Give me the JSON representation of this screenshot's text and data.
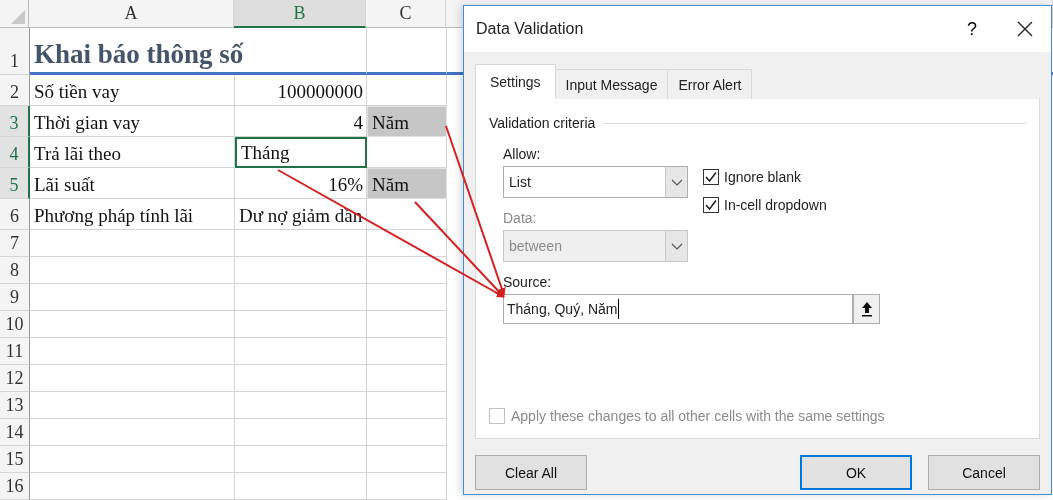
{
  "sheet": {
    "columns": [
      {
        "label": "A",
        "selected": false
      },
      {
        "label": "B",
        "selected": true
      },
      {
        "label": "C",
        "selected": false
      }
    ],
    "rows": [
      {
        "number": "1",
        "selected": false,
        "cells": [
          {
            "text": "Khai báo thông số",
            "kind": "title",
            "selected": false,
            "shaded": false
          },
          {
            "selected": false,
            "shaded": false
          },
          {
            "selected": false,
            "shaded": false
          }
        ]
      },
      {
        "number": "2",
        "selected": false,
        "cells": [
          {
            "text": "Số tiền vay",
            "kind": "text",
            "selected": false,
            "shaded": false
          },
          {
            "text": "100000000",
            "kind": "number",
            "selected": false,
            "shaded": false
          },
          {
            "selected": false,
            "shaded": false
          }
        ]
      },
      {
        "number": "3",
        "selected": true,
        "cells": [
          {
            "text": "Thời gian vay",
            "kind": "text",
            "selected": false,
            "shaded": false
          },
          {
            "text": "4",
            "kind": "number",
            "selected": false,
            "shaded": false
          },
          {
            "text": "Năm",
            "kind": "text",
            "selected": false,
            "shaded": true
          }
        ]
      },
      {
        "number": "4",
        "selected": true,
        "cells": [
          {
            "text": "Trả lãi theo",
            "kind": "text",
            "selected": false,
            "shaded": false
          },
          {
            "text": "Tháng",
            "kind": "text",
            "selected": true,
            "shaded": false
          },
          {
            "selected": false,
            "shaded": false
          }
        ]
      },
      {
        "number": "5",
        "selected": true,
        "cells": [
          {
            "text": "Lãi suất",
            "kind": "text",
            "selected": false,
            "shaded": false
          },
          {
            "text": "16%",
            "kind": "number",
            "selected": false,
            "shaded": false
          },
          {
            "text": "Năm",
            "kind": "text",
            "selected": false,
            "shaded": true
          }
        ]
      },
      {
        "number": "6",
        "selected": false,
        "cells": [
          {
            "text": "Phương pháp tính lãi",
            "kind": "text",
            "selected": false,
            "shaded": false
          },
          {
            "text": "Dư nợ giảm dần",
            "kind": "text",
            "selected": false,
            "shaded": false
          },
          {
            "selected": false,
            "shaded": false
          }
        ]
      },
      {
        "number": "7",
        "selected": false,
        "cells": []
      },
      {
        "number": "8",
        "selected": false,
        "cells": []
      },
      {
        "number": "9",
        "selected": false,
        "cells": []
      },
      {
        "number": "10",
        "selected": false,
        "cells": []
      },
      {
        "number": "11",
        "selected": false,
        "cells": []
      },
      {
        "number": "12",
        "selected": false,
        "cells": []
      },
      {
        "number": "13",
        "selected": false,
        "cells": []
      },
      {
        "number": "14",
        "selected": false,
        "cells": []
      },
      {
        "number": "15",
        "selected": false,
        "cells": []
      },
      {
        "number": "16",
        "selected": false,
        "cells": []
      }
    ]
  },
  "dialog": {
    "title": "Data Validation",
    "help": "?",
    "tabs": [
      {
        "label": "Settings",
        "selected": true
      },
      {
        "label": "Input Message",
        "selected": false
      },
      {
        "label": "Error Alert",
        "selected": false
      }
    ],
    "section": "Validation criteria",
    "allow": {
      "label": "Allow:",
      "value": "List",
      "disabled": false
    },
    "data": {
      "label": "Data:",
      "value": "between",
      "disabled": true
    },
    "checkboxes": [
      {
        "label": "Ignore blank",
        "checked": true,
        "disabled": false
      },
      {
        "label": "In-cell dropdown",
        "checked": true,
        "disabled": false
      }
    ],
    "source": {
      "label": "Source:",
      "value": "Tháng, Quý, Năm"
    },
    "apply": {
      "label": "Apply these changes to all other cells with the same settings",
      "checked": false,
      "disabled": true
    },
    "buttons": [
      {
        "label": "Clear All",
        "default": false
      },
      {
        "label": "OK",
        "default": true
      },
      {
        "label": "Cancel",
        "default": false
      }
    ]
  }
}
